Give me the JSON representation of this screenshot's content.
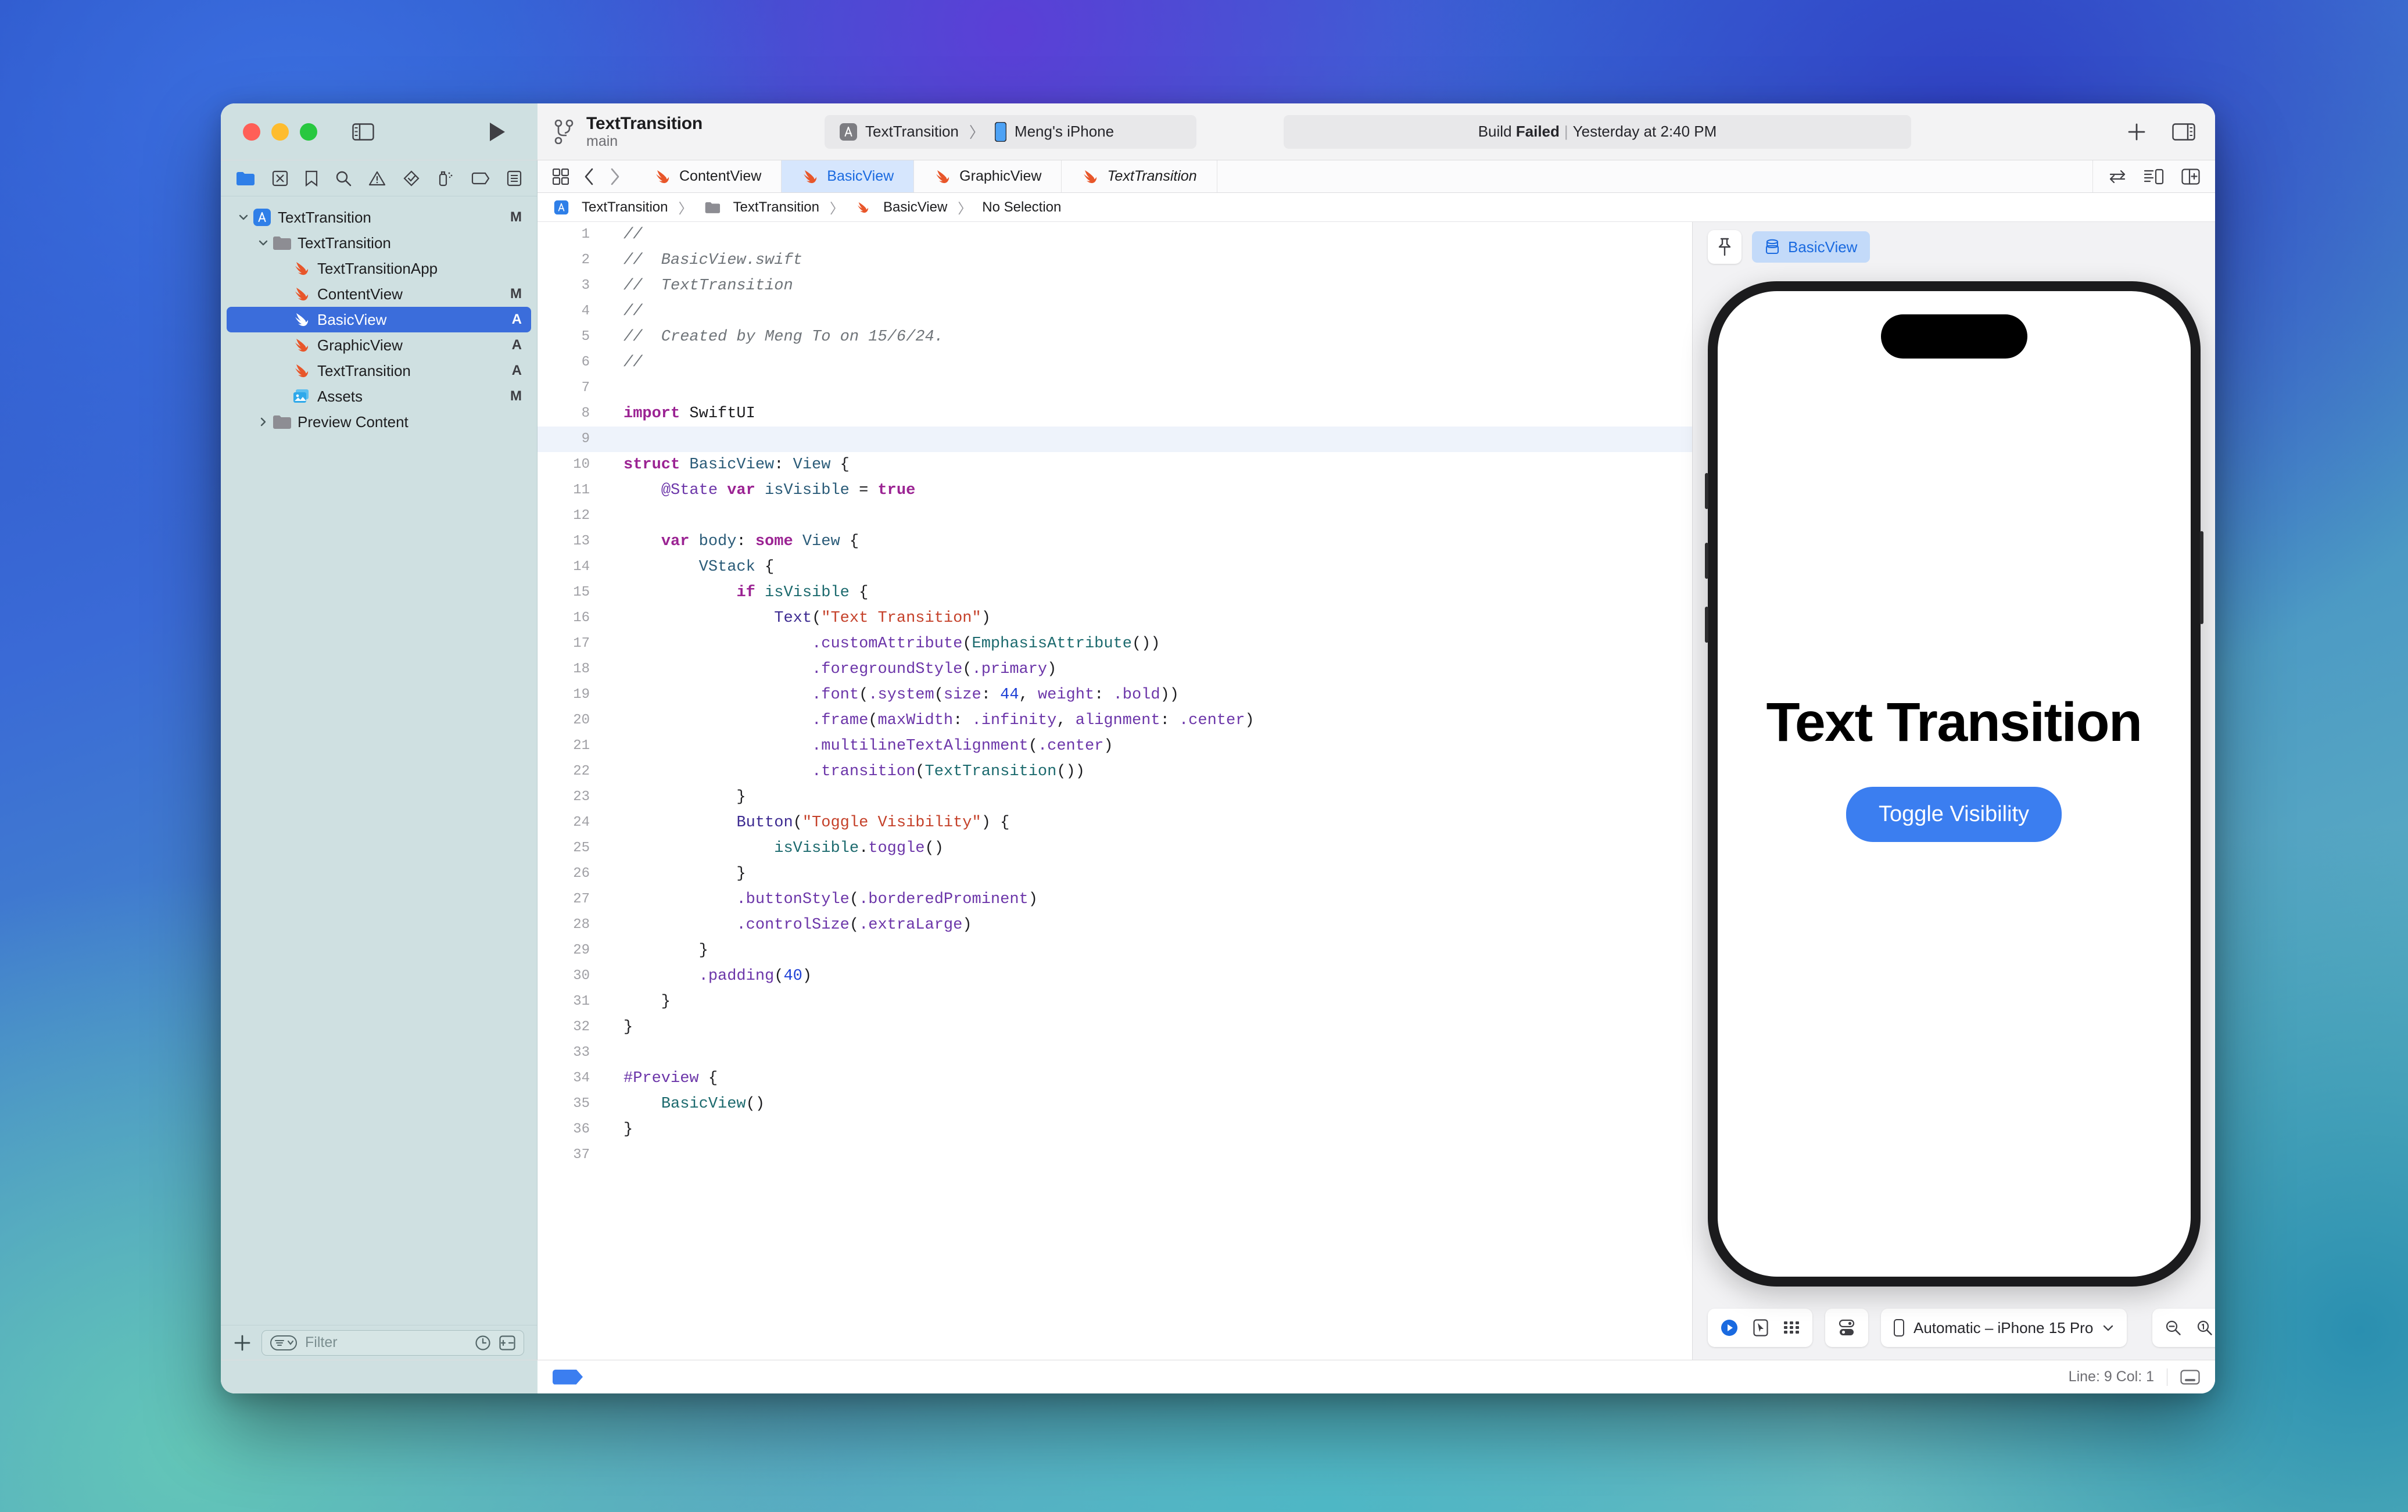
{
  "window": {
    "traffic_lights": [
      "close",
      "minimize",
      "zoom"
    ]
  },
  "toolbar": {
    "scheme_name": "TextTransition",
    "branch": "main",
    "destination_project": "TextTransition",
    "destination_separator": "〉",
    "destination_device": "Meng's iPhone",
    "build_status_prefix": "Build ",
    "build_status_value": "Failed",
    "build_status_pipe": "|",
    "build_status_time": "Yesterday at 2:40 PM",
    "add_button_label": "+",
    "icons": {
      "sidebar_toggle": "sidebar-toggle-icon",
      "run": "run-play-icon",
      "branch": "source-control-branch-icon",
      "app": "app-store-app-icon",
      "device": "iphone-icon",
      "add": "plus-icon",
      "inspector_toggle": "inspector-toggle-icon"
    }
  },
  "navigator": {
    "toolbar_icons": [
      "folder-icon",
      "source-control-icon",
      "bookmark-icon",
      "search-icon",
      "warning-triangle-icon",
      "test-diamond-icon",
      "debug-spray-icon",
      "breakpoint-tag-icon",
      "report-list-icon"
    ],
    "tree": [
      {
        "label": "TextTransition",
        "icon": "app-project-icon",
        "indent": 0,
        "disclosure": "open",
        "badge": "M",
        "selected": false
      },
      {
        "label": "TextTransition",
        "icon": "folder-icon",
        "indent": 1,
        "disclosure": "open",
        "badge": "",
        "selected": false
      },
      {
        "label": "TextTransitionApp",
        "icon": "swift-file-icon",
        "indent": 2,
        "disclosure": "",
        "badge": "",
        "selected": false
      },
      {
        "label": "ContentView",
        "icon": "swift-file-icon",
        "indent": 2,
        "disclosure": "",
        "badge": "M",
        "selected": false
      },
      {
        "label": "BasicView",
        "icon": "swift-file-icon",
        "indent": 2,
        "disclosure": "",
        "badge": "A",
        "selected": true
      },
      {
        "label": "GraphicView",
        "icon": "swift-file-icon",
        "indent": 2,
        "disclosure": "",
        "badge": "A",
        "selected": false
      },
      {
        "label": "TextTransition",
        "icon": "swift-file-icon",
        "indent": 2,
        "disclosure": "",
        "badge": "A",
        "selected": false
      },
      {
        "label": "Assets",
        "icon": "assets-catalog-icon",
        "indent": 2,
        "disclosure": "",
        "badge": "M",
        "selected": false
      },
      {
        "label": "Preview Content",
        "icon": "folder-icon",
        "indent": 1,
        "disclosure": "closed",
        "badge": "",
        "selected": false
      }
    ],
    "footer": {
      "add_label": "+",
      "filter_placeholder": "Filter",
      "filter_value": "",
      "filter_scope_icon": "filter-scope-icon",
      "recent_icon": "clock-icon",
      "source-control_icon": "source-control-filter-icon"
    }
  },
  "editor": {
    "tabs": [
      {
        "label": "ContentView",
        "icon": "swift-file-icon",
        "active": false,
        "italic": false
      },
      {
        "label": "BasicView",
        "icon": "swift-file-icon",
        "active": true,
        "italic": false
      },
      {
        "label": "GraphicView",
        "icon": "swift-file-icon",
        "active": false,
        "italic": false
      },
      {
        "label": "TextTransition",
        "icon": "swift-file-icon",
        "active": false,
        "italic": true
      }
    ],
    "tab_left_icons": [
      "grid-tabs-icon",
      "back-chevron-icon",
      "forward-chevron-icon"
    ],
    "tab_right_icons": [
      "swap-editors-icon",
      "minimap-icon",
      "add-editor-icon"
    ],
    "jumpbar": [
      {
        "label": "TextTransition",
        "icon": "app-project-icon"
      },
      {
        "label": "TextTransition",
        "icon": "folder-icon"
      },
      {
        "label": "BasicView",
        "icon": "swift-file-icon"
      },
      {
        "label": "No Selection",
        "icon": ""
      }
    ],
    "jumpbar_separator": "〉",
    "code_lines": [
      {
        "n": 1,
        "cursor": false,
        "ribbon": "",
        "tokens": [
          {
            "t": "//",
            "c": "c-com"
          }
        ]
      },
      {
        "n": 2,
        "cursor": false,
        "ribbon": "",
        "tokens": [
          {
            "t": "//  BasicView.swift",
            "c": "c-com"
          }
        ]
      },
      {
        "n": 3,
        "cursor": false,
        "ribbon": "",
        "tokens": [
          {
            "t": "//  TextTransition",
            "c": "c-com"
          }
        ]
      },
      {
        "n": 4,
        "cursor": false,
        "ribbon": "",
        "tokens": [
          {
            "t": "//",
            "c": "c-com"
          }
        ]
      },
      {
        "n": 5,
        "cursor": false,
        "ribbon": "",
        "tokens": [
          {
            "t": "//  Created by Meng To on 15/6/24.",
            "c": "c-com"
          }
        ]
      },
      {
        "n": 6,
        "cursor": false,
        "ribbon": "",
        "tokens": [
          {
            "t": "//",
            "c": "c-com"
          }
        ]
      },
      {
        "n": 7,
        "cursor": false,
        "ribbon": "",
        "tokens": []
      },
      {
        "n": 8,
        "cursor": false,
        "ribbon": "",
        "tokens": [
          {
            "t": "import",
            "c": "c-kw"
          },
          {
            "t": " SwiftUI",
            "c": "c-pln"
          }
        ]
      },
      {
        "n": 9,
        "cursor": true,
        "ribbon": "",
        "tokens": []
      },
      {
        "n": 10,
        "cursor": false,
        "ribbon": "",
        "tokens": [
          {
            "t": "struct",
            "c": "c-kw"
          },
          {
            "t": " ",
            "c": "c-pln"
          },
          {
            "t": "BasicView",
            "c": "c-typ"
          },
          {
            "t": ": ",
            "c": "c-pln"
          },
          {
            "t": "View",
            "c": "c-typ"
          },
          {
            "t": " {",
            "c": "c-pln"
          }
        ]
      },
      {
        "n": 11,
        "cursor": false,
        "ribbon": "cap-top",
        "tokens": [
          {
            "t": "    ",
            "c": "c-pln"
          },
          {
            "t": "@State",
            "c": "c-mem"
          },
          {
            "t": " ",
            "c": "c-pln"
          },
          {
            "t": "var",
            "c": "c-kw"
          },
          {
            "t": " ",
            "c": "c-pln"
          },
          {
            "t": "isVisible",
            "c": "c-typ"
          },
          {
            "t": " = ",
            "c": "c-pln"
          },
          {
            "t": "true",
            "c": "c-kw"
          }
        ]
      },
      {
        "n": 12,
        "cursor": false,
        "ribbon": "cap-bot",
        "tokens": []
      },
      {
        "n": 13,
        "cursor": false,
        "ribbon": "",
        "tokens": [
          {
            "t": "    ",
            "c": "c-pln"
          },
          {
            "t": "var",
            "c": "c-kw"
          },
          {
            "t": " ",
            "c": "c-pln"
          },
          {
            "t": "body",
            "c": "c-typ"
          },
          {
            "t": ": ",
            "c": "c-pln"
          },
          {
            "t": "some",
            "c": "c-kw"
          },
          {
            "t": " ",
            "c": "c-pln"
          },
          {
            "t": "View",
            "c": "c-typ"
          },
          {
            "t": " {",
            "c": "c-pln"
          }
        ]
      },
      {
        "n": 14,
        "cursor": false,
        "ribbon": "cap-top",
        "tokens": [
          {
            "t": "        ",
            "c": "c-pln"
          },
          {
            "t": "VStack",
            "c": "c-typ"
          },
          {
            "t": " {",
            "c": "c-pln"
          }
        ]
      },
      {
        "n": 15,
        "cursor": false,
        "ribbon": "on",
        "tokens": [
          {
            "t": "            ",
            "c": "c-pln"
          },
          {
            "t": "if",
            "c": "c-kw"
          },
          {
            "t": " ",
            "c": "c-pln"
          },
          {
            "t": "isVisible",
            "c": "c-typ2"
          },
          {
            "t": " {",
            "c": "c-pln"
          }
        ]
      },
      {
        "n": 16,
        "cursor": false,
        "ribbon": "on",
        "tokens": [
          {
            "t": "                ",
            "c": "c-pln"
          },
          {
            "t": "Text",
            "c": "c-fn"
          },
          {
            "t": "(",
            "c": "c-pln"
          },
          {
            "t": "\"Text Transition\"",
            "c": "c-str"
          },
          {
            "t": ")",
            "c": "c-pln"
          }
        ]
      },
      {
        "n": 17,
        "cursor": false,
        "ribbon": "on",
        "tokens": [
          {
            "t": "                    ",
            "c": "c-pln"
          },
          {
            "t": ".customAttribute",
            "c": "c-mem"
          },
          {
            "t": "(",
            "c": "c-pln"
          },
          {
            "t": "EmphasisAttribute",
            "c": "c-typ2"
          },
          {
            "t": "())",
            "c": "c-pln"
          }
        ]
      },
      {
        "n": 18,
        "cursor": false,
        "ribbon": "on",
        "tokens": [
          {
            "t": "                    ",
            "c": "c-pln"
          },
          {
            "t": ".foregroundStyle",
            "c": "c-mem"
          },
          {
            "t": "(",
            "c": "c-pln"
          },
          {
            "t": ".primary",
            "c": "c-mem"
          },
          {
            "t": ")",
            "c": "c-pln"
          }
        ]
      },
      {
        "n": 19,
        "cursor": false,
        "ribbon": "on",
        "tokens": [
          {
            "t": "                    ",
            "c": "c-pln"
          },
          {
            "t": ".font",
            "c": "c-mem"
          },
          {
            "t": "(",
            "c": "c-pln"
          },
          {
            "t": ".system",
            "c": "c-mem"
          },
          {
            "t": "(",
            "c": "c-pln"
          },
          {
            "t": "size",
            "c": "c-mem"
          },
          {
            "t": ": ",
            "c": "c-pln"
          },
          {
            "t": "44",
            "c": "c-num"
          },
          {
            "t": ", ",
            "c": "c-pln"
          },
          {
            "t": "weight",
            "c": "c-mem"
          },
          {
            "t": ": ",
            "c": "c-pln"
          },
          {
            "t": ".bold",
            "c": "c-mem"
          },
          {
            "t": "))",
            "c": "c-pln"
          }
        ]
      },
      {
        "n": 20,
        "cursor": false,
        "ribbon": "on",
        "tokens": [
          {
            "t": "                    ",
            "c": "c-pln"
          },
          {
            "t": ".frame",
            "c": "c-mem"
          },
          {
            "t": "(",
            "c": "c-pln"
          },
          {
            "t": "maxWidth",
            "c": "c-mem"
          },
          {
            "t": ": ",
            "c": "c-pln"
          },
          {
            "t": ".infinity",
            "c": "c-mem"
          },
          {
            "t": ", ",
            "c": "c-pln"
          },
          {
            "t": "alignment",
            "c": "c-mem"
          },
          {
            "t": ": ",
            "c": "c-pln"
          },
          {
            "t": ".center",
            "c": "c-mem"
          },
          {
            "t": ")",
            "c": "c-pln"
          }
        ]
      },
      {
        "n": 21,
        "cursor": false,
        "ribbon": "on",
        "tokens": [
          {
            "t": "                    ",
            "c": "c-pln"
          },
          {
            "t": ".multilineTextAlignment",
            "c": "c-mem"
          },
          {
            "t": "(",
            "c": "c-pln"
          },
          {
            "t": ".center",
            "c": "c-mem"
          },
          {
            "t": ")",
            "c": "c-pln"
          }
        ]
      },
      {
        "n": 22,
        "cursor": false,
        "ribbon": "on",
        "tokens": [
          {
            "t": "                    ",
            "c": "c-pln"
          },
          {
            "t": ".transition",
            "c": "c-mem"
          },
          {
            "t": "(",
            "c": "c-pln"
          },
          {
            "t": "TextTransition",
            "c": "c-typ2"
          },
          {
            "t": "())",
            "c": "c-pln"
          }
        ]
      },
      {
        "n": 23,
        "cursor": false,
        "ribbon": "on",
        "tokens": [
          {
            "t": "            }",
            "c": "c-pln"
          }
        ]
      },
      {
        "n": 24,
        "cursor": false,
        "ribbon": "on",
        "tokens": [
          {
            "t": "            ",
            "c": "c-pln"
          },
          {
            "t": "Button",
            "c": "c-fn"
          },
          {
            "t": "(",
            "c": "c-pln"
          },
          {
            "t": "\"Toggle Visibility\"",
            "c": "c-str"
          },
          {
            "t": ") {",
            "c": "c-pln"
          }
        ]
      },
      {
        "n": 25,
        "cursor": false,
        "ribbon": "on",
        "tokens": [
          {
            "t": "                ",
            "c": "c-pln"
          },
          {
            "t": "isVisible",
            "c": "c-typ2"
          },
          {
            "t": ".",
            "c": "c-pln"
          },
          {
            "t": "toggle",
            "c": "c-mem"
          },
          {
            "t": "()",
            "c": "c-pln"
          }
        ]
      },
      {
        "n": 26,
        "cursor": false,
        "ribbon": "on",
        "tokens": [
          {
            "t": "            }",
            "c": "c-pln"
          }
        ]
      },
      {
        "n": 27,
        "cursor": false,
        "ribbon": "on",
        "tokens": [
          {
            "t": "            ",
            "c": "c-pln"
          },
          {
            "t": ".buttonStyle",
            "c": "c-mem"
          },
          {
            "t": "(",
            "c": "c-pln"
          },
          {
            "t": ".borderedProminent",
            "c": "c-mem"
          },
          {
            "t": ")",
            "c": "c-pln"
          }
        ]
      },
      {
        "n": 28,
        "cursor": false,
        "ribbon": "on",
        "tokens": [
          {
            "t": "            ",
            "c": "c-pln"
          },
          {
            "t": ".controlSize",
            "c": "c-mem"
          },
          {
            "t": "(",
            "c": "c-pln"
          },
          {
            "t": ".extraLarge",
            "c": "c-mem"
          },
          {
            "t": ")",
            "c": "c-pln"
          }
        ]
      },
      {
        "n": 29,
        "cursor": false,
        "ribbon": "on",
        "tokens": [
          {
            "t": "        }",
            "c": "c-pln"
          }
        ]
      },
      {
        "n": 30,
        "cursor": false,
        "ribbon": "cap-bot",
        "tokens": [
          {
            "t": "        ",
            "c": "c-pln"
          },
          {
            "t": ".padding",
            "c": "c-mem"
          },
          {
            "t": "(",
            "c": "c-pln"
          },
          {
            "t": "40",
            "c": "c-num"
          },
          {
            "t": ")",
            "c": "c-pln"
          }
        ]
      },
      {
        "n": 31,
        "cursor": false,
        "ribbon": "",
        "tokens": [
          {
            "t": "    }",
            "c": "c-pln"
          }
        ]
      },
      {
        "n": 32,
        "cursor": false,
        "ribbon": "",
        "tokens": [
          {
            "t": "}",
            "c": "c-pln"
          }
        ]
      },
      {
        "n": 33,
        "cursor": false,
        "ribbon": "",
        "tokens": []
      },
      {
        "n": 34,
        "cursor": false,
        "ribbon": "",
        "tokens": [
          {
            "t": "#Preview",
            "c": "c-mem"
          },
          {
            "t": " {",
            "c": "c-pln"
          }
        ]
      },
      {
        "n": 35,
        "cursor": false,
        "ribbon": "",
        "tokens": [
          {
            "t": "    ",
            "c": "c-pln"
          },
          {
            "t": "BasicView",
            "c": "c-typ2"
          },
          {
            "t": "()",
            "c": "c-pln"
          }
        ]
      },
      {
        "n": 36,
        "cursor": false,
        "ribbon": "",
        "tokens": [
          {
            "t": "}",
            "c": "c-pln"
          }
        ]
      },
      {
        "n": 37,
        "cursor": false,
        "ribbon": "",
        "tokens": []
      }
    ]
  },
  "canvas": {
    "pin_icon": "pin-icon",
    "preview_chip_icon": "preview-cube-icon",
    "preview_chip_label": "BasicView",
    "device_frame": "iphone-15-pro",
    "preview": {
      "title": "Text Transition",
      "button_label": "Toggle Visibility",
      "button_color": "#3b7ef0"
    },
    "controls": {
      "live_icon": "live-preview-play-icon",
      "select_icon": "selectable-pointer-icon",
      "variants_icon": "variants-grid-icon",
      "device_settings_icon": "device-settings-icon",
      "device_icon": "iphone-icon",
      "device_label": "Automatic – iPhone 15 Pro",
      "device_chevron": "chevron-down-icon",
      "zoom_out_icon": "zoom-out-icon",
      "zoom_100_icon": "zoom-actual-size-icon",
      "zoom_fit_icon": "zoom-to-fit-icon",
      "zoom_in_icon": "zoom-in-icon"
    }
  },
  "statusbar": {
    "breakpoint_tag": "breakpoint-indicator",
    "line_col": "Line: 9  Col: 1",
    "console_toggle_icon": "console-toggle-icon"
  }
}
